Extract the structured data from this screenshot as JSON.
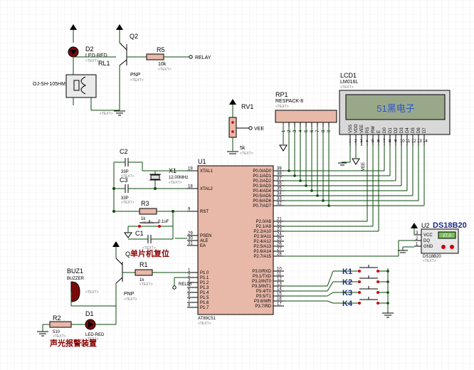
{
  "title_chinese": {
    "reset": "单片机复位",
    "alarm": "声光报警装置"
  },
  "components": {
    "d2": {
      "ref": "D2",
      "value": "LED-RED",
      "tag": "<TEXT>"
    },
    "rl1": {
      "ref": "RL1",
      "value": "OJ-SH-105HM",
      "tag": "<TEXT>"
    },
    "q2": {
      "ref": "Q2",
      "value": "PNP",
      "tag": "<TEXT>"
    },
    "r5": {
      "ref": "R5",
      "value": "10k",
      "tag": "<TEXT>"
    },
    "relay_net": "RELAY",
    "rv1": {
      "ref": "RV1",
      "value": "5k",
      "tag": "<TEXT>",
      "net": "VEE"
    },
    "rp1": {
      "ref": "RP1",
      "value": "RESPACK-8",
      "tag": "<TEXT>",
      "pins": [
        "1",
        "2",
        "3",
        "4",
        "5",
        "6",
        "7",
        "8",
        "9"
      ]
    },
    "lcd1": {
      "ref": "LCD1",
      "value": "LM016L",
      "tag": "<TEXT>",
      "display": "51黑电子",
      "pins": [
        "VSS",
        "VDD",
        "VEE",
        "RS",
        "RW",
        "E",
        "D0",
        "D1",
        "D2",
        "D3",
        "D4",
        "D5",
        "D6",
        "D7"
      ],
      "nums": [
        "1",
        "2",
        "3",
        "4",
        "5",
        "6",
        "7",
        "8",
        "9",
        "10",
        "11",
        "12",
        "13",
        "14"
      ],
      "vee_net": "VEE"
    },
    "c2": {
      "ref": "C2",
      "value": "33P",
      "tag": "<TEXT>"
    },
    "c3": {
      "ref": "C3",
      "value": "33P",
      "tag": "<TEXT>"
    },
    "x1": {
      "ref": "X1",
      "value": "12.00MHz",
      "tag": "<TEXT>"
    },
    "r3": {
      "ref": "R3",
      "value": "1k",
      "tag": "<TEXT>"
    },
    "c1": {
      "ref": "C1",
      "value": "0.1uF",
      "tag": "<TEXT>"
    },
    "q1": {
      "ref": "Q1",
      "value": "PNP",
      "tag": "<TEXT>"
    },
    "r1": {
      "ref": "R1",
      "value": "1k",
      "tag": "<TEXT>"
    },
    "buz1": {
      "ref": "BUZ1",
      "value": "BUZZER",
      "tag": "<TEXT>"
    },
    "r2": {
      "ref": "R2",
      "value": "510",
      "tag": "<TEXT>"
    },
    "d1": {
      "ref": "D1",
      "value": "LED-RED",
      "tag": "<TEXT>"
    },
    "u1": {
      "ref": "U1",
      "value": "AT89C51",
      "tag": "<TEXT>",
      "left_pins": [
        {
          "num": "19",
          "name": "XTAL1"
        },
        {
          "num": "18",
          "name": "XTAL2"
        },
        {
          "num": "9",
          "name": "RST"
        },
        {
          "num": "29",
          "name": "PSEN"
        },
        {
          "num": "30",
          "name": "ALE"
        },
        {
          "num": "31",
          "name": "EA"
        },
        {
          "num": "1",
          "name": "P1.0"
        },
        {
          "num": "2",
          "name": "P1.1"
        },
        {
          "num": "3",
          "name": "P1.2"
        },
        {
          "num": "4",
          "name": "P1.3"
        },
        {
          "num": "5",
          "name": "P1.4"
        },
        {
          "num": "6",
          "name": "P1.5"
        },
        {
          "num": "7",
          "name": "P1.6"
        },
        {
          "num": "8",
          "name": "P1.7"
        }
      ],
      "right_pins": [
        {
          "num": "39",
          "name": "P0.0/AD0"
        },
        {
          "num": "38",
          "name": "P0.1/AD1"
        },
        {
          "num": "37",
          "name": "P0.2/AD2"
        },
        {
          "num": "36",
          "name": "P0.3/AD3"
        },
        {
          "num": "35",
          "name": "P0.4/AD4"
        },
        {
          "num": "34",
          "name": "P0.5/AD5"
        },
        {
          "num": "33",
          "name": "P0.6/AD6"
        },
        {
          "num": "32",
          "name": "P0.7/AD7"
        },
        {
          "num": "21",
          "name": "P2.0/A8"
        },
        {
          "num": "22",
          "name": "P2.1/A9"
        },
        {
          "num": "23",
          "name": "P2.2/A10"
        },
        {
          "num": "24",
          "name": "P2.3/A11"
        },
        {
          "num": "25",
          "name": "P2.4/A12"
        },
        {
          "num": "26",
          "name": "P2.5/A13"
        },
        {
          "num": "27",
          "name": "P2.6/A14"
        },
        {
          "num": "28",
          "name": "P2.7/A15"
        },
        {
          "num": "10",
          "name": "P3.0/RXD"
        },
        {
          "num": "11",
          "name": "P3.1/TXD"
        },
        {
          "num": "12",
          "name": "P3.2/INT0"
        },
        {
          "num": "13",
          "name": "P3.3/INT1"
        },
        {
          "num": "14",
          "name": "P3.4/T0"
        },
        {
          "num": "15",
          "name": "P3.5/T1"
        },
        {
          "num": "16",
          "name": "P3.6/WR"
        },
        {
          "num": "17",
          "name": "P3.7/RD"
        }
      ]
    },
    "u2": {
      "ref": "U2",
      "part": "DS18B20",
      "value": "DS18B20",
      "tag": "<TEXT>",
      "reading": "27.0",
      "pins": [
        {
          "num": "3",
          "name": "VCC"
        },
        {
          "num": "2",
          "name": "DQ"
        },
        {
          "num": "1",
          "name": "GND"
        }
      ]
    },
    "keys": [
      "K1",
      "K2",
      "K3",
      "K4"
    ]
  },
  "colors": {
    "wire": "#0a4a0a",
    "lcd_bg": "#9aa88a",
    "lcd_text": "#2a55c8",
    "chip_body": "#e8b8a8",
    "grid": "#e2e2e2",
    "accent_blue": "#1a2a8a",
    "cn_red": "#8b0000"
  }
}
